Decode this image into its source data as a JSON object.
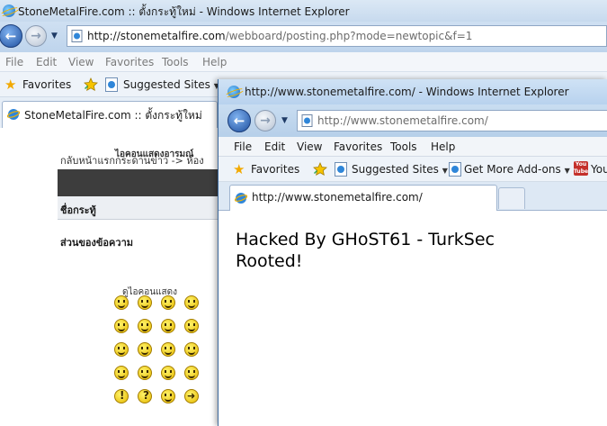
{
  "back_window": {
    "title": "StoneMetalFire.com :: ตั้งกระทู้ใหม่ - Windows Internet Explorer",
    "address_host": "http://stonemetalfire.com",
    "address_path": "/webboard/posting.php?mode=newtopic&f=1",
    "menu": [
      "File",
      "Edit",
      "View",
      "Favorites",
      "Tools",
      "Help"
    ],
    "favorites_label": "Favorites",
    "suggested_sites": "Suggested Sites",
    "tab_label": "StoneMetalFire.com :: ตั้งกระทู้ใหม่",
    "breadcrumb": "กลับหน้าแรกกระดานข่าว -> ห้อง ",
    "subject_label": "ชื่อกระทู้",
    "message_label": "ส่วนของข้อความ",
    "smilies_title": "ไอคอนแสดงอารมณ์",
    "more_smilies": "ดูไอคอนแสดง"
  },
  "front_window": {
    "title": "http://www.stonemetalfire.com/ - Windows Internet Explorer",
    "address": "http://www.stonemetalfire.com/",
    "menu": [
      "File",
      "Edit",
      "View",
      "Favorites",
      "Tools",
      "Help"
    ],
    "favorites_label": "Favorites",
    "suggested_sites": "Suggested Sites",
    "get_more_addons": "Get More Add-ons",
    "youtube_label": "You",
    "tab_label": "http://www.stonemetalfire.com/",
    "page_line1": "Hacked By GHoST61 - TurkSec",
    "page_line2": "Rooted!"
  },
  "icons": {
    "smilies": [
      [
        "grin",
        "smile",
        "sad",
        "surprised"
      ],
      [
        "eek",
        "confused",
        "cool",
        "lol"
      ],
      [
        "mad",
        "razz",
        "redface",
        "cry"
      ],
      [
        "evil",
        "twisted",
        "rolleyes",
        "wink"
      ],
      [
        "exclaim",
        "question",
        "idea",
        "arrow"
      ]
    ]
  }
}
